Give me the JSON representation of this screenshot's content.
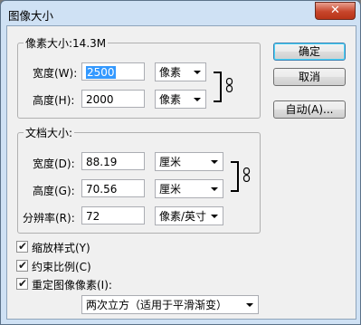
{
  "window": {
    "title": "图像大小",
    "close_glyph": "✕"
  },
  "pixel_dimensions": {
    "label": "像素大小:14.3M",
    "width": {
      "label": "宽度(W):",
      "value": "2500",
      "unit": "像素"
    },
    "height": {
      "label": "高度(H):",
      "value": "2000",
      "unit": "像素"
    }
  },
  "document_size": {
    "label": "文档大小:",
    "width": {
      "label": "宽度(D):",
      "value": "88.19",
      "unit": "厘米"
    },
    "height": {
      "label": "高度(G):",
      "value": "70.56",
      "unit": "厘米"
    },
    "resolution": {
      "label": "分辨率(R):",
      "value": "72",
      "unit": "像素/英寸"
    }
  },
  "buttons": {
    "ok": "确定",
    "cancel": "取消",
    "auto": "自动(A)..."
  },
  "options": {
    "scale_styles": {
      "label": "缩放样式(Y)",
      "checked": true,
      "mark": "✔"
    },
    "constrain": {
      "label": "约束比例(C)",
      "checked": true,
      "mark": "✔"
    },
    "resample": {
      "label": "重定图像像素(I):",
      "checked": true,
      "mark": "✔"
    },
    "resample_method": "两次立方（适用于平滑渐变）"
  }
}
